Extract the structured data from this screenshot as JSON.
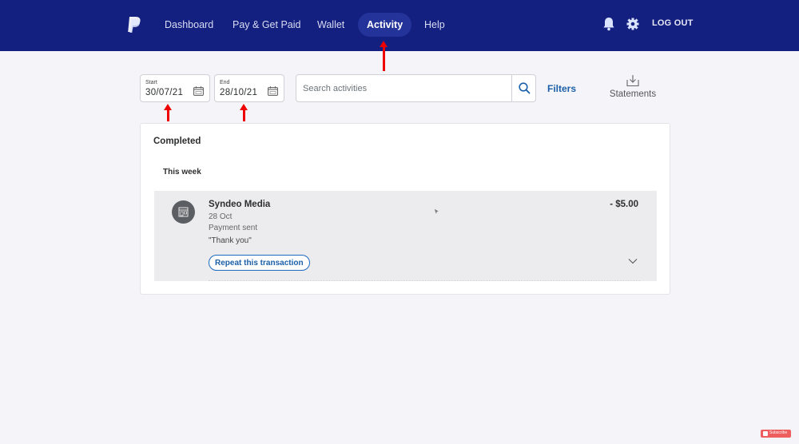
{
  "header": {
    "logo": "paypal-logo",
    "nav": [
      {
        "label": "Dashboard",
        "active": false
      },
      {
        "label": "Pay & Get Paid",
        "active": false
      },
      {
        "label": "Wallet",
        "active": false
      },
      {
        "label": "Activity",
        "active": true
      },
      {
        "label": "Help",
        "active": false
      }
    ],
    "icons": [
      "bell-icon",
      "gear-icon"
    ],
    "logout_label": "LOG OUT"
  },
  "filters": {
    "start": {
      "label": "Start",
      "value": "30/07/21",
      "icon": "calendar-icon"
    },
    "end": {
      "label": "End",
      "value": "28/10/21",
      "icon": "calendar-icon"
    },
    "search": {
      "placeholder": "Search activities",
      "value": "",
      "icon": "search-icon"
    },
    "filters_label": "Filters",
    "statements": {
      "label": "Statements",
      "icon": "download-icon"
    }
  },
  "activity": {
    "title": "Completed",
    "groups": [
      {
        "label": "This week",
        "transactions": [
          {
            "name": "Syndeo Media",
            "date": "28 Oct",
            "type": "Payment sent",
            "note": "\"Thank you\"",
            "amount": "- $5.00",
            "action_label": "Repeat this transaction",
            "icon": "merchant-store-icon"
          }
        ]
      }
    ]
  },
  "annotations": {
    "arrow_color": "#ee0000",
    "arrows": [
      "activity-tab",
      "start-date",
      "end-date"
    ]
  },
  "colors": {
    "header_bg": "#142080",
    "active_tab_bg": "#24339a",
    "link_blue": "#1b5fa8",
    "page_bg": "#f5f5f9",
    "row_bg": "#ececee"
  },
  "overlay": {
    "subscribe_label": "Subscribe"
  }
}
